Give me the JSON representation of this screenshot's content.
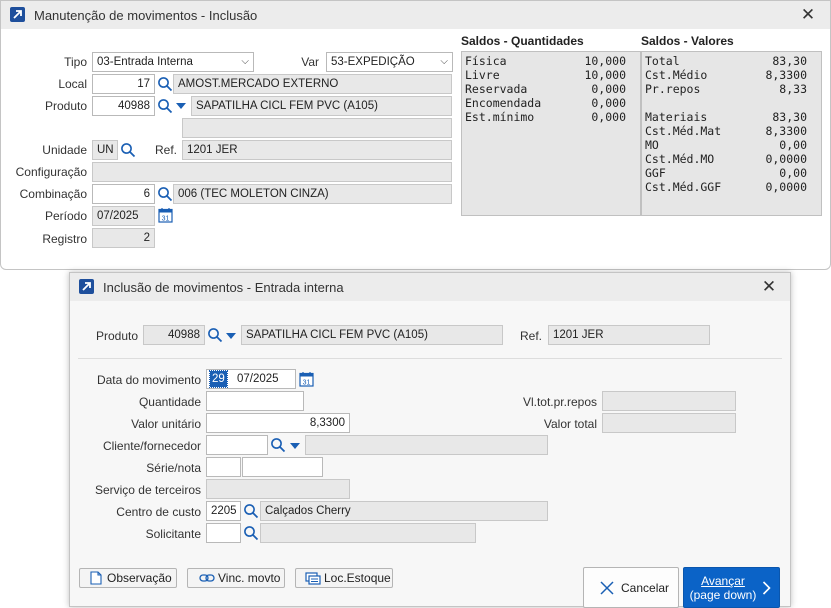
{
  "main_window": {
    "title": "Manutenção de movimentos - Inclusão",
    "tipo": {
      "label": "Tipo",
      "value": "03-Entrada Interna"
    },
    "var": {
      "label": "Var",
      "value": "53-EXPEDIÇÃO"
    },
    "local": {
      "label": "Local",
      "code": "17",
      "name": "AMOST.MERCADO EXTERNO"
    },
    "produto": {
      "label": "Produto",
      "code": "40988",
      "name": "SAPATILHA CICL FEM PVC (A105)"
    },
    "unidade": {
      "label": "Unidade",
      "value": "UN"
    },
    "ref": {
      "label": "Ref.",
      "value": "1201 JER"
    },
    "configuracao": {
      "label": "Configuração",
      "value": ""
    },
    "combinacao": {
      "label": "Combinação",
      "code": "6",
      "name": "006 (TEC MOLETON CINZA)"
    },
    "periodo": {
      "label": "Período",
      "value": "07/2025"
    },
    "registro": {
      "label": "Registro",
      "value": "2"
    },
    "saldos_qtd": {
      "title": "Saldos - Quantidades",
      "rows": [
        {
          "k": "Física",
          "v": "10,000"
        },
        {
          "k": "Livre",
          "v": "10,000"
        },
        {
          "k": "Reservada",
          "v": "0,000"
        },
        {
          "k": "Encomendada",
          "v": "0,000"
        },
        {
          "k": "Est.mínimo",
          "v": "0,000"
        }
      ]
    },
    "saldos_val": {
      "title": "Saldos - Valores",
      "rows": [
        {
          "k": "Total",
          "v": "83,30"
        },
        {
          "k": "Cst.Médio",
          "v": "8,3300"
        },
        {
          "k": "Pr.repos",
          "v": "8,33"
        },
        {
          "k": "",
          "v": ""
        },
        {
          "k": "Materiais",
          "v": "83,30"
        },
        {
          "k": "Cst.Méd.Mat",
          "v": "8,3300"
        },
        {
          "k": "MO",
          "v": "0,00"
        },
        {
          "k": "Cst.Méd.MO",
          "v": "0,0000"
        },
        {
          "k": "GGF",
          "v": "0,00"
        },
        {
          "k": "Cst.Méd.GGF",
          "v": "0,0000"
        }
      ]
    }
  },
  "dialog": {
    "title": "Inclusão de movimentos - Entrada interna",
    "produto": {
      "label": "Produto",
      "code": "40988",
      "name": "SAPATILHA CICL FEM PVC (A105)"
    },
    "ref": {
      "label": "Ref.",
      "value": "1201 JER"
    },
    "data": {
      "label": "Data do movimento",
      "day": "29",
      "month": "07/2025"
    },
    "quantidade": {
      "label": "Quantidade",
      "value": ""
    },
    "vl_tot_pr_repos": {
      "label": "Vl.tot.pr.repos",
      "value": ""
    },
    "valor_unitario": {
      "label": "Valor unitário",
      "value": "8,3300"
    },
    "valor_total": {
      "label": "Valor total",
      "value": ""
    },
    "cliente": {
      "label": "Cliente/fornecedor",
      "code": "",
      "name": ""
    },
    "serie_nota": {
      "label": "Série/nota",
      "serie": "",
      "nota": ""
    },
    "servico": {
      "label": "Serviço de terceiros",
      "value": ""
    },
    "centro_custo": {
      "label": "Centro de custo",
      "code": "2205",
      "name": "Calçados Cherry"
    },
    "solicitante": {
      "label": "Solicitante",
      "code": "",
      "name": ""
    },
    "buttons": {
      "observacao": "Observação",
      "vinc_movto": "Vinc. movto",
      "loc_estoque": "Loc.Estoque",
      "cancelar": "Cancelar",
      "avancar": "Avançar",
      "avancar_sub": "(page down)"
    },
    "colors": {
      "accent": "#1a5fb4",
      "primary_button": "#0b63c7"
    }
  }
}
